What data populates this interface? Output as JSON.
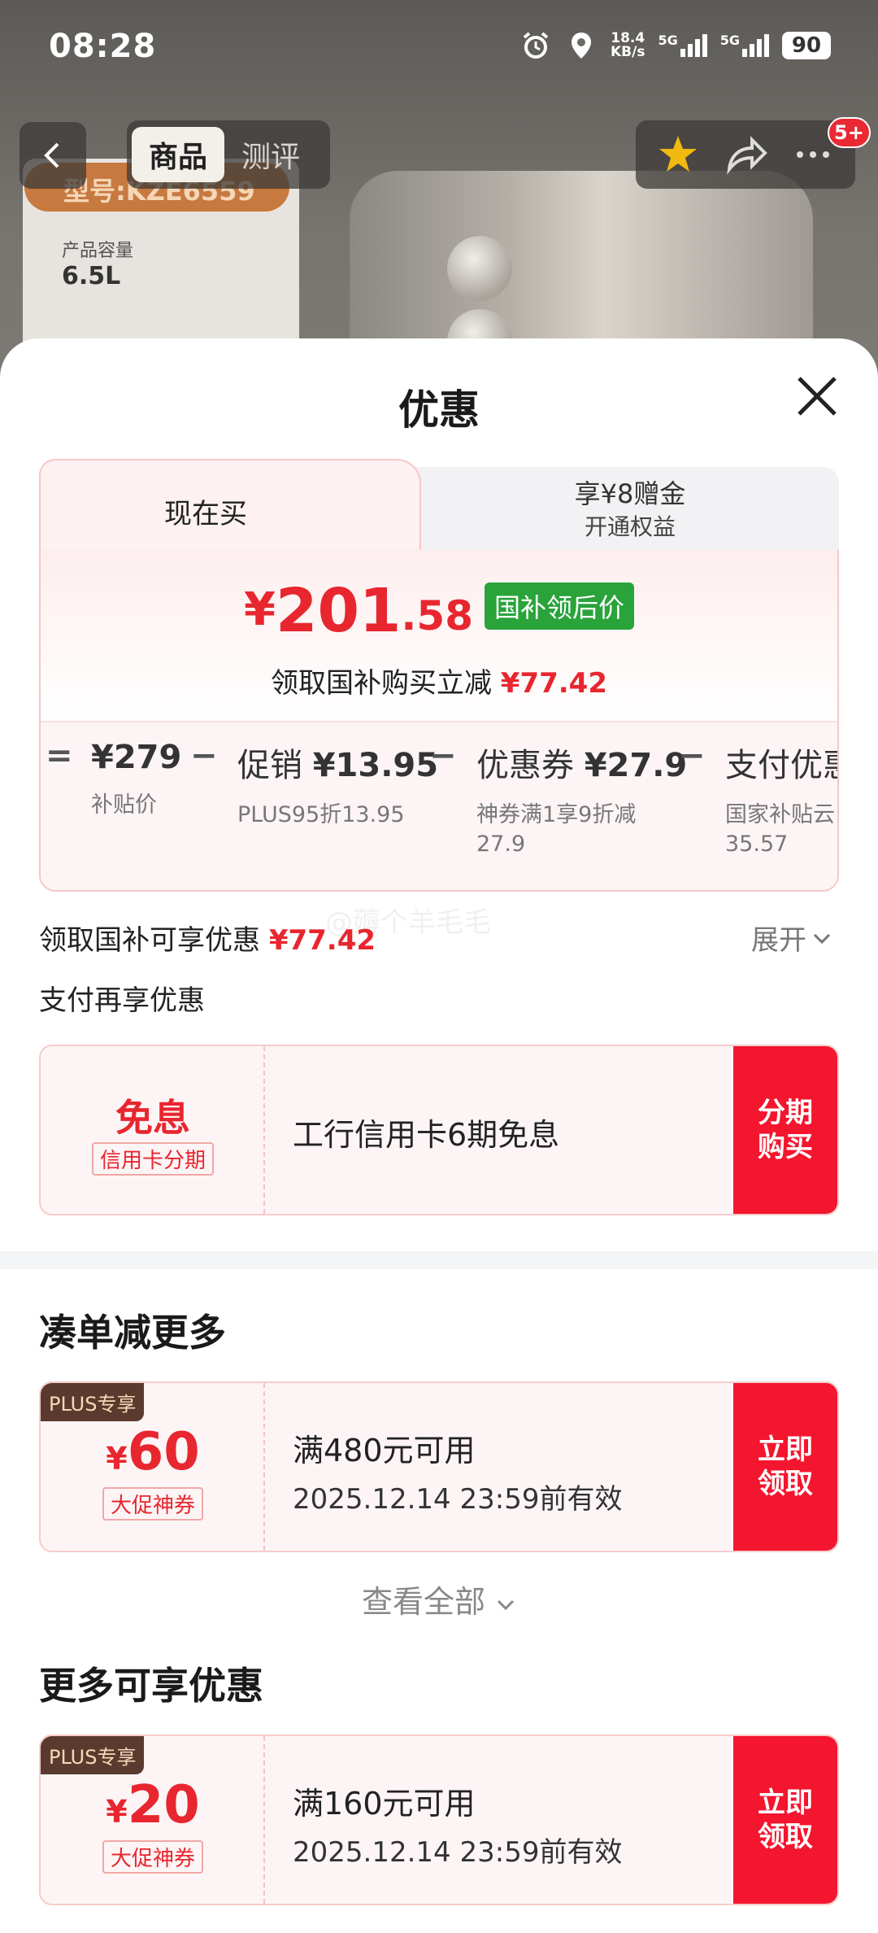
{
  "status_bar": {
    "time": "08:28",
    "speed_value": "18.4",
    "speed_unit": "KB/s",
    "net1": "5G",
    "net2": "5G",
    "battery": "90",
    "icons": [
      "alarm-icon",
      "location-icon",
      "signal-icon",
      "signal-icon",
      "battery-icon"
    ]
  },
  "nav": {
    "tabs": [
      {
        "label": "商品",
        "active": true
      },
      {
        "label": "测评",
        "active": false
      }
    ],
    "badge": "5+",
    "actions": [
      "favorite-star-icon",
      "share-icon",
      "more-icon"
    ]
  },
  "background": {
    "model_badge": "型号:KZE6559",
    "spec_label": "产品容量",
    "spec_value": "6.5L"
  },
  "sheet": {
    "title": "优惠",
    "tabs": {
      "left": "现在买",
      "right_line1": "享¥8赠金",
      "right_line2": "开通权益"
    },
    "price": {
      "yen": "¥",
      "integer": "201",
      "decimal": ".58",
      "tag": "国补领后价",
      "sub_text": "领取国补购买立减",
      "sub_amount": "¥77.42"
    },
    "calc": [
      {
        "op": "=",
        "label": "",
        "value": "¥279",
        "note": "补贴价"
      },
      {
        "op": "−",
        "label": "促销",
        "value": "¥13.95",
        "note": "PLUS95折13.95"
      },
      {
        "op": "−",
        "label": "优惠券",
        "value": "¥27.9",
        "note": "神券满1享9折减",
        "note2": "27.9"
      },
      {
        "op": "−",
        "label": "支付优惠",
        "value": "",
        "note": "国家补贴云",
        "note2": "35.57"
      }
    ],
    "subsidy_row": {
      "text": "领取国补可享优惠",
      "amount": "¥77.42",
      "expand": "展开"
    },
    "pay_more_title": "支付再享优惠",
    "installment_card": {
      "title": "免息",
      "tag": "信用卡分期",
      "desc": "工行信用卡6期免息",
      "button": "分期购买"
    },
    "combine_section": {
      "title": "凑单减更多",
      "coupon": {
        "plus_tag": "PLUS专享",
        "yen": "¥",
        "amount": "60",
        "tag": "大促神券",
        "condition": "满480元可用",
        "validity": "2025.12.14 23:59前有效",
        "button": "立即领取"
      },
      "view_all": "查看全部"
    },
    "more_section": {
      "title": "更多可享优惠",
      "coupon": {
        "plus_tag": "PLUS专享",
        "yen": "¥",
        "amount": "20",
        "tag": "大促神券",
        "condition": "满160元可用",
        "validity": "2025.12.14 23:59前有效",
        "button": "立即领取"
      }
    },
    "watermark": "@薅个羊毛毛"
  },
  "colors": {
    "accent_red": "#e8262f",
    "button_red": "#f4152e",
    "subsidy_green": "#29a33a",
    "plus_brown": "#5a3a2e"
  }
}
